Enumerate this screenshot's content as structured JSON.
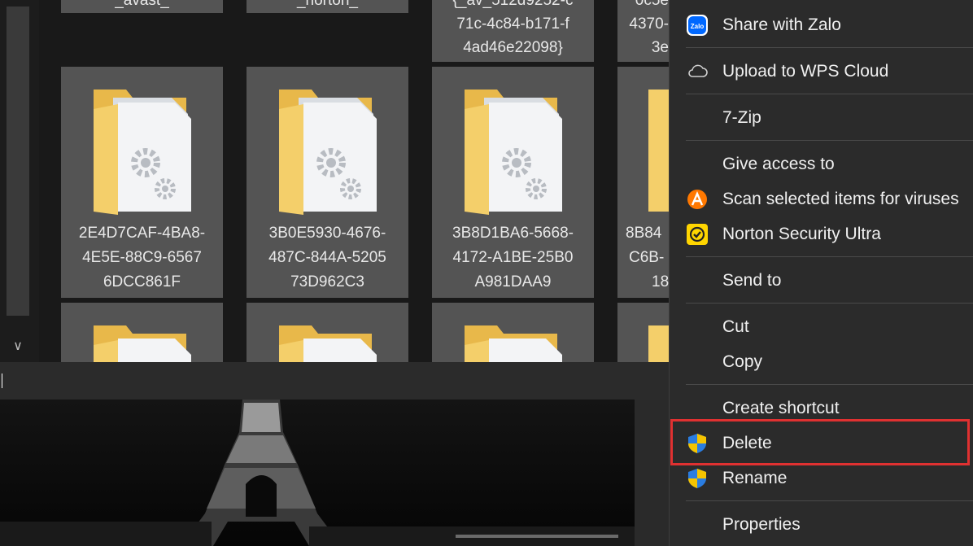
{
  "explorer": {
    "top_row": [
      {
        "lines": [
          "_avast_"
        ]
      },
      {
        "lines": [
          "_norton_"
        ]
      },
      {
        "lines": [
          "{_av_512d9252-c",
          "71c-4c84-b171-f",
          "4ad46e22098}"
        ]
      },
      {
        "lines": [
          "0c5e",
          "4370-",
          "3e"
        ]
      }
    ],
    "folders": [
      {
        "lines": [
          "2E4D7CAF-4BA8-",
          "4E5E-88C9-6567",
          "6DCC861F"
        ]
      },
      {
        "lines": [
          "3B0E5930-4676-",
          "487C-844A-5205",
          "73D962C3"
        ]
      },
      {
        "lines": [
          "3B8D1BA6-5668-",
          "4172-A1BE-25B0",
          "A981DAA9"
        ]
      },
      {
        "lines": [
          "8B84",
          "C6B-",
          "18"
        ]
      }
    ]
  },
  "context_menu": {
    "items": [
      {
        "label": "Share with Zalo",
        "icon": "zalo-icon",
        "underline": "S"
      },
      {
        "label": "Upload to WPS Cloud",
        "icon": "cloud-icon"
      },
      {
        "label": "7-Zip"
      },
      {
        "label": "Give access to",
        "underline": "G"
      },
      {
        "label": "Scan selected items for viruses",
        "icon": "avast-icon",
        "underline": "S"
      },
      {
        "label": "Norton Security Ultra",
        "icon": "norton-icon"
      },
      {
        "label": "Send to",
        "underline": "n"
      },
      {
        "label": "Cut",
        "underline": "t"
      },
      {
        "label": "Copy",
        "underline": "C"
      },
      {
        "label": "Create shortcut",
        "underline": "s"
      },
      {
        "label": "Delete",
        "icon": "uac-shield-icon",
        "underline": "D"
      },
      {
        "label": "Rename",
        "icon": "uac-shield-icon",
        "underline": "m"
      },
      {
        "label": "Properties",
        "underline": "r"
      }
    ],
    "highlighted": "Delete"
  },
  "colors": {
    "menu_bg": "#2b2b2b",
    "highlight_border": "#e03131",
    "folder_yellow": "#f4cf6a",
    "norton_yellow": "#ffd500",
    "zalo_blue": "#0068ff"
  }
}
